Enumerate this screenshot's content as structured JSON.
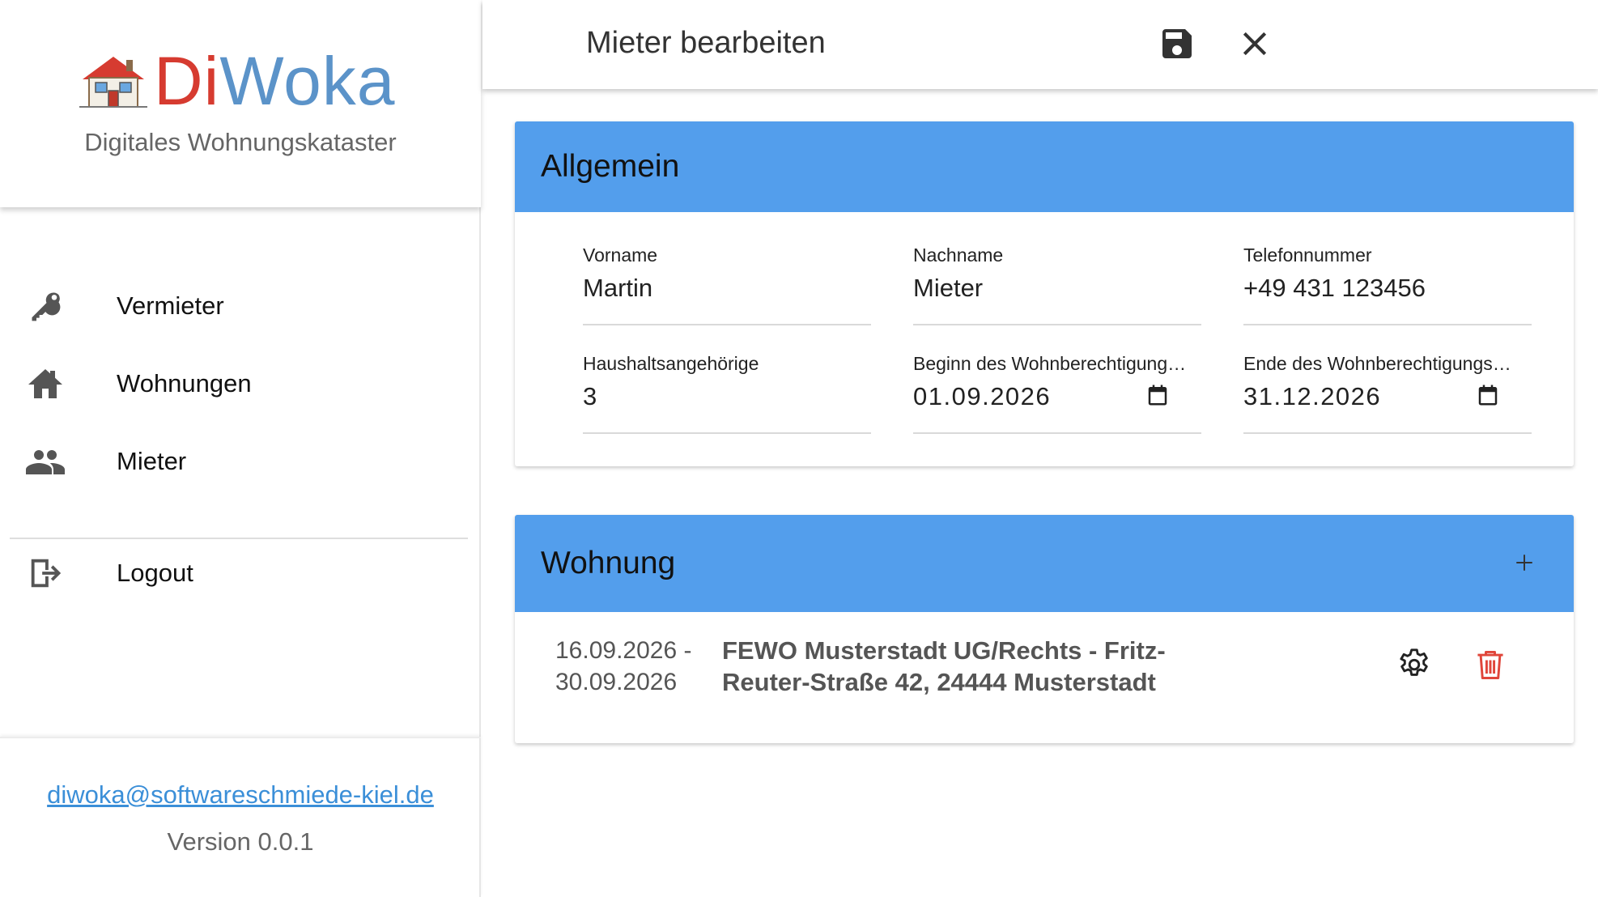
{
  "brand": {
    "logo_di": "Di",
    "logo_woka": "Woka",
    "subtitle": "Digitales Wohnungskataster",
    "colors": {
      "di": "#d63b30",
      "woka": "#5b93c9"
    }
  },
  "nav": {
    "items": [
      {
        "label": "Vermieter",
        "icon": "key-icon"
      },
      {
        "label": "Wohnungen",
        "icon": "home-icon"
      },
      {
        "label": "Mieter",
        "icon": "people-icon"
      }
    ],
    "logout": {
      "label": "Logout",
      "icon": "logout-icon"
    }
  },
  "footer": {
    "email": "diwoka@softwareschmiede-kiel.de",
    "version": "Version 0.0.1"
  },
  "header": {
    "title": "Mieter bearbeiten",
    "save_icon": "save-icon",
    "close_icon": "close-icon"
  },
  "allgemein": {
    "title": "Allgemein",
    "fields": {
      "vorname": {
        "label": "Vorname",
        "value": "Martin"
      },
      "nachname": {
        "label": "Nachname",
        "value": "Mieter"
      },
      "telefon": {
        "label": "Telefonnummer",
        "value": "+49 431 123456"
      },
      "haushalt": {
        "label": "Haushaltsangehörige",
        "value": "3"
      },
      "beginn": {
        "label": "Beginn des Wohnberechtigungszeitraums",
        "value": "01.09.2026"
      },
      "ende": {
        "label": "Ende des Wohnberechtigungszeitraums",
        "value": "31.12.2026"
      }
    }
  },
  "wohnung": {
    "title": "Wohnung",
    "add_icon": "plus-icon",
    "entries": [
      {
        "dates": "16.09.2026 - 30.09.2026",
        "address": "FEWO Musterstadt UG/Rechts - Fritz-Reuter-Straße 42, 24444 Musterstadt"
      }
    ]
  },
  "colors": {
    "accent": "#539eec",
    "delete": "#e0453a",
    "link": "#3b8fd8"
  }
}
